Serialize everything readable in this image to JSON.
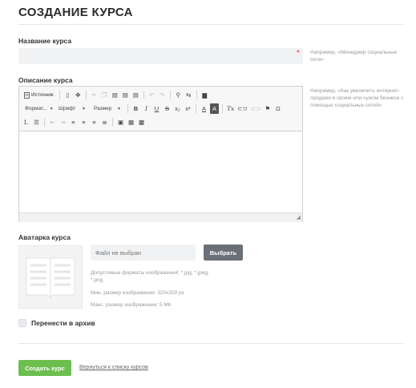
{
  "page": {
    "title": "СОЗДАНИЕ КУРСА"
  },
  "name_field": {
    "label": "Название курса",
    "required_mark": "*",
    "value": "",
    "placeholder": "",
    "hint": "Например, «Менеджер социальные сети»"
  },
  "description_field": {
    "label": "Описание курса",
    "required_mark": "*",
    "hint": "Например, «Как увеличить интернет-продажи в своем или чужом бизнесе с помощью социальных сетей»",
    "toolbar": {
      "source_label": "Источник",
      "format_label": "Формат...",
      "font_label": "Шрифт",
      "size_label": "Размер",
      "bold": "B",
      "italic": "I",
      "underline": "U",
      "strike": "S",
      "subscript": "x₂",
      "superscript": "x²",
      "text_color": "A",
      "bg_color": "A",
      "clear_format": "Tx",
      "omega": "Ω"
    }
  },
  "avatar": {
    "label": "Аватарка курса",
    "file_placeholder": "Файл не выбран",
    "choose_button": "Выбрать",
    "formats": "Допустимые форматы изображений: *.jpg, *.jpeg, *.png",
    "min_size": "Мин. размер изображения: 320х320 px",
    "max_size": "Макс. размер изображения: 5 Mb"
  },
  "archive": {
    "label": "Перенести в архив",
    "checked": false
  },
  "actions": {
    "create_button": "Создать курс",
    "back_link": "Вернуться к списку курсов"
  },
  "colors": {
    "accent_green": "#6cbf4f",
    "button_gray": "#6b6f78",
    "required_red": "#e53935"
  },
  "icons": [
    "source-icon",
    "new-page-icon",
    "maximize-icon",
    "cut-icon",
    "copy-icon",
    "paste-icon",
    "paste-text-icon",
    "paste-word-icon",
    "undo-icon",
    "redo-icon",
    "find-icon",
    "replace-icon",
    "blocks-icon",
    "link-icon",
    "unlink-icon",
    "anchor-icon",
    "numbered-list-icon",
    "bulleted-list-icon",
    "outdent-icon",
    "indent-icon",
    "align-left-icon",
    "align-center-icon",
    "align-right-icon",
    "justify-icon",
    "image-icon",
    "table-icon",
    "media-icon",
    "book-placeholder-icon"
  ]
}
